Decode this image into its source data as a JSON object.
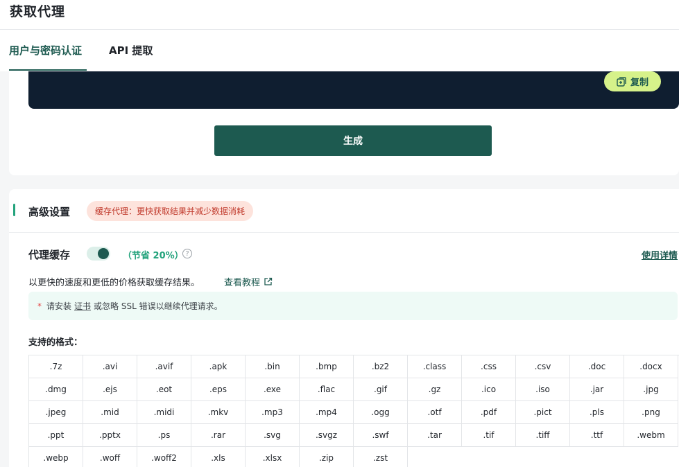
{
  "page": {
    "title": "获取代理"
  },
  "tabs": [
    {
      "label": "用户与密码认证",
      "active": true
    },
    {
      "label": "API 提取",
      "active": false
    }
  ],
  "generator": {
    "copy_label": "复制",
    "copy_icon": "copy-icon",
    "generate_label": "生成"
  },
  "advanced": {
    "title": "高级设置",
    "badge": "缓存代理：更快获取结果并减少数据消耗",
    "cache": {
      "label": "代理缓存",
      "enabled": true,
      "saving": "（节省 20%）",
      "help_icon": "question-circle-icon",
      "usage_link": "使用详情"
    },
    "description": "以更快的速度和更低的价格获取缓存结果。",
    "tutorial_link": "查看教程",
    "notice": {
      "star": "*",
      "before": "请安装",
      "cert_link": "证书",
      "after": "或忽略 SSL 错误以继续代理请求。"
    },
    "formats_label": "支持的格式：",
    "formats": [
      ".7z",
      ".avi",
      ".avif",
      ".apk",
      ".bin",
      ".bmp",
      ".bz2",
      ".class",
      ".css",
      ".csv",
      ".doc",
      ".docx",
      ".dmg",
      ".ejs",
      ".eot",
      ".eps",
      ".exe",
      ".flac",
      ".gif",
      ".gz",
      ".ico",
      ".iso",
      ".jar",
      ".jpg",
      ".jpeg",
      ".mid",
      ".midi",
      ".mkv",
      ".mp3",
      ".mp4",
      ".ogg",
      ".otf",
      ".pdf",
      ".pict",
      ".pls",
      ".png",
      ".ppt",
      ".pptx",
      ".ps",
      ".rar",
      ".svg",
      ".svgz",
      ".swf",
      ".tar",
      ".tif",
      ".tiff",
      ".ttf",
      ".webm",
      ".webp",
      ".woff",
      ".woff2",
      ".xls",
      ".xlsx",
      ".zip",
      ".zst"
    ]
  },
  "colors": {
    "brand": "#1d5a50",
    "accent_green": "#23a37c",
    "copy_button": "#d6f28a",
    "code_bg": "#0f1e30",
    "badge_bg": "#fde3dc",
    "badge_text": "#c0392b"
  }
}
